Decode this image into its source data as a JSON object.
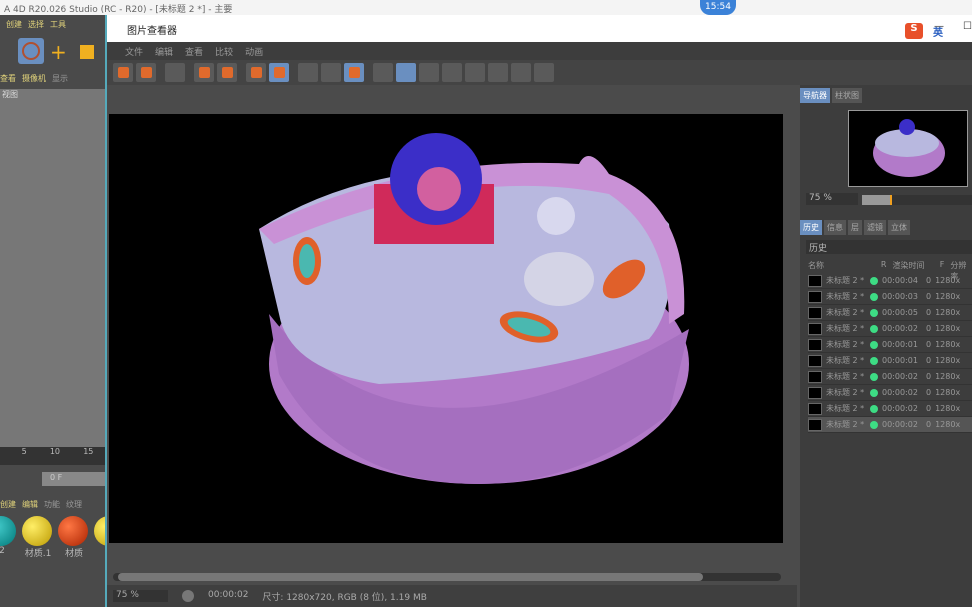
{
  "app_title": "A 4D R20.026 Studio (RC - R20) - [未标题 2 *] - 主要",
  "clock": "15:54",
  "left_menu": [
    "创建",
    "选择",
    "工具",
    "网"
  ],
  "left_sub": [
    "查看",
    "摄像机",
    "显示",
    "选"
  ],
  "left_view": "视图",
  "timeline_ticks": [
    "5",
    "10",
    "15"
  ],
  "frame_field": "0 F",
  "mat_tabs": [
    "创建",
    "编辑",
    "功能",
    "纹理"
  ],
  "materials": [
    "2",
    "材质.1",
    "材质",
    "材"
  ],
  "viewer": {
    "title": "图片查看器",
    "menu": [
      "文件",
      "编辑",
      "查看",
      "比较",
      "动画"
    ],
    "status": {
      "zoom": "75 %",
      "time": "00:00:02",
      "info": "尺寸: 1280x720, RGB (8 位), 1.19 MB"
    }
  },
  "ime": "英",
  "right": {
    "nav_tabs": [
      "导航器",
      "柱状图"
    ],
    "nav_zoom": "75 %",
    "info_tabs": [
      "历史",
      "信息",
      "层",
      "滤镜",
      "立体"
    ],
    "history_label": "历史",
    "columns": [
      "名称",
      "R",
      "渲染时间",
      "F",
      "分辨率"
    ],
    "rows": [
      {
        "name": "未标题 2 *",
        "time": "00:00:04",
        "f": "0",
        "res": "1280x"
      },
      {
        "name": "未标题 2 *",
        "time": "00:00:03",
        "f": "0",
        "res": "1280x"
      },
      {
        "name": "未标题 2 *",
        "time": "00:00:05",
        "f": "0",
        "res": "1280x"
      },
      {
        "name": "未标题 2 *",
        "time": "00:00:02",
        "f": "0",
        "res": "1280x"
      },
      {
        "name": "未标题 2 *",
        "time": "00:00:01",
        "f": "0",
        "res": "1280x"
      },
      {
        "name": "未标题 2 *",
        "time": "00:00:01",
        "f": "0",
        "res": "1280x"
      },
      {
        "name": "未标题 2 *",
        "time": "00:00:02",
        "f": "0",
        "res": "1280x"
      },
      {
        "name": "未标题 2 *",
        "time": "00:00:02",
        "f": "0",
        "res": "1280x"
      },
      {
        "name": "未标题 2 *",
        "time": "00:00:02",
        "f": "0",
        "res": "1280x"
      },
      {
        "name": "未标题 2 *",
        "time": "00:00:02",
        "f": "0",
        "res": "1280x"
      }
    ]
  }
}
